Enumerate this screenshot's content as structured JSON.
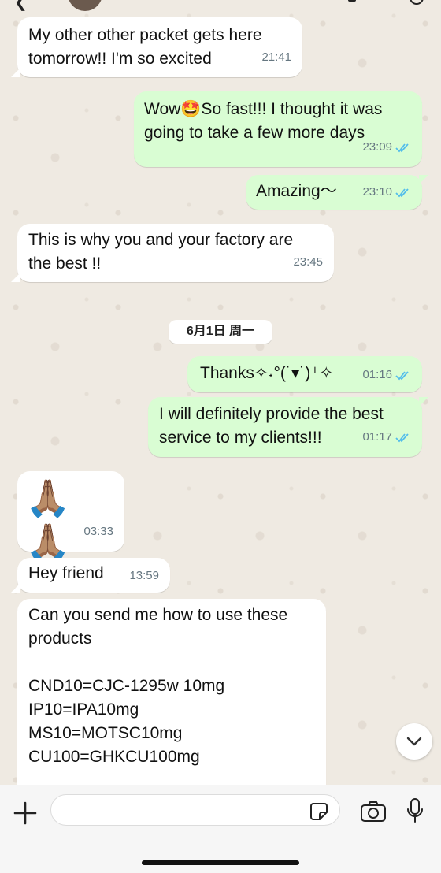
{
  "messages": [
    {
      "text": "My other other packet gets here\ntomorrow!! I'm so excited",
      "time": "21:41"
    },
    {
      "text": "Wow🤩So fast!!! I thought it was\ngoing to take a few more days",
      "time": "23:09"
    },
    {
      "text": "Amazing～",
      "time": "23:10"
    },
    {
      "text": "This is why you and your factory are\nthe best !!",
      "time": "23:45"
    },
    {
      "text": "Thanks✧˖°(˙▾˙)⁺✧",
      "time": "01:16"
    },
    {
      "text": "I will definitely provide the best\nservice to my clients!!!",
      "time": "01:17"
    },
    {
      "text": "🙏🏽🙏🏽",
      "time": "03:33"
    },
    {
      "text": "Hey friend",
      "time": "13:59"
    },
    {
      "text": "Can you send me how to use these\nproducts\n\nCND10=CJC-1295w 10mg\nIP10=IPA10mg\nMS10=MOTSC10mg\nCU100=GHKCU100mg"
    }
  ],
  "date_separator": "6月1日 周一",
  "colors": {
    "incoming": "#ffffff",
    "outgoing": "#d9fdd3",
    "read_ticks": "#53bdeb",
    "timestamp": "#667781",
    "background": "#efeae2"
  },
  "icons": {
    "back": "chevron-left-icon",
    "attach": "plus-icon",
    "sticker": "sticker-icon",
    "camera": "camera-icon",
    "microphone": "microphone-icon",
    "scroll_down": "chevron-down-icon",
    "read_receipt": "double-check-icon"
  }
}
